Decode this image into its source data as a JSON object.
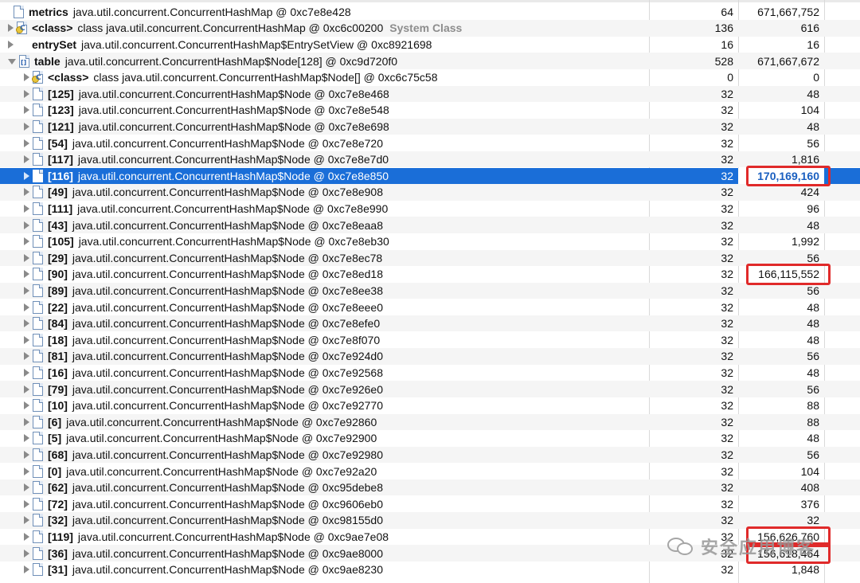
{
  "rows": [
    {
      "indent": 0,
      "toggle": "none",
      "icon": "file",
      "key": "metrics",
      "val": "java.util.concurrent.ConcurrentHashMap @ 0xc7e8e428",
      "shallow": "64",
      "retained": "671,667,752"
    },
    {
      "indent": 1,
      "toggle": "right",
      "icon": "class",
      "key": "<class>",
      "val": "class java.util.concurrent.ConcurrentHashMap @ 0xc6c00200",
      "extra": "System Class",
      "shallow": "136",
      "retained": "616"
    },
    {
      "indent": 1,
      "toggle": "right",
      "icon": "none",
      "key": "entrySet",
      "val": "java.util.concurrent.ConcurrentHashMap$EntrySetView @ 0xc8921698",
      "shallow": "16",
      "retained": "16"
    },
    {
      "indent": 1,
      "toggle": "down",
      "icon": "array",
      "key": "table",
      "val": "java.util.concurrent.ConcurrentHashMap$Node[128] @ 0xc9d720f0",
      "shallow": "528",
      "retained": "671,667,672"
    },
    {
      "indent": 2,
      "toggle": "right",
      "icon": "class",
      "key": "<class>",
      "val": "class java.util.concurrent.ConcurrentHashMap$Node[] @ 0xc6c75c58",
      "shallow": "0",
      "retained": "0"
    },
    {
      "indent": 2,
      "toggle": "right",
      "icon": "file",
      "key": "[125]",
      "val": "java.util.concurrent.ConcurrentHashMap$Node @ 0xc7e8e468",
      "shallow": "32",
      "retained": "48"
    },
    {
      "indent": 2,
      "toggle": "right",
      "icon": "file",
      "key": "[123]",
      "val": "java.util.concurrent.ConcurrentHashMap$Node @ 0xc7e8e548",
      "shallow": "32",
      "retained": "104"
    },
    {
      "indent": 2,
      "toggle": "right",
      "icon": "file",
      "key": "[121]",
      "val": "java.util.concurrent.ConcurrentHashMap$Node @ 0xc7e8e698",
      "shallow": "32",
      "retained": "48"
    },
    {
      "indent": 2,
      "toggle": "right",
      "icon": "file",
      "key": "[54]",
      "val": "java.util.concurrent.ConcurrentHashMap$Node @ 0xc7e8e720",
      "shallow": "32",
      "retained": "56"
    },
    {
      "indent": 2,
      "toggle": "right",
      "icon": "file",
      "key": "[117]",
      "val": "java.util.concurrent.ConcurrentHashMap$Node @ 0xc7e8e7d0",
      "shallow": "32",
      "retained": "1,816"
    },
    {
      "indent": 2,
      "toggle": "right",
      "icon": "file",
      "key": "[116]",
      "val": "java.util.concurrent.ConcurrentHashMap$Node @ 0xc7e8e850",
      "shallow": "32",
      "retained": "170,169,160",
      "selected": true,
      "highlight": true
    },
    {
      "indent": 2,
      "toggle": "right",
      "icon": "file",
      "key": "[49]",
      "val": "java.util.concurrent.ConcurrentHashMap$Node @ 0xc7e8e908",
      "shallow": "32",
      "retained": "424"
    },
    {
      "indent": 2,
      "toggle": "right",
      "icon": "file",
      "key": "[111]",
      "val": "java.util.concurrent.ConcurrentHashMap$Node @ 0xc7e8e990",
      "shallow": "32",
      "retained": "96"
    },
    {
      "indent": 2,
      "toggle": "right",
      "icon": "file",
      "key": "[43]",
      "val": "java.util.concurrent.ConcurrentHashMap$Node @ 0xc7e8eaa8",
      "shallow": "32",
      "retained": "48"
    },
    {
      "indent": 2,
      "toggle": "right",
      "icon": "file",
      "key": "[105]",
      "val": "java.util.concurrent.ConcurrentHashMap$Node @ 0xc7e8eb30",
      "shallow": "32",
      "retained": "1,992"
    },
    {
      "indent": 2,
      "toggle": "right",
      "icon": "file",
      "key": "[29]",
      "val": "java.util.concurrent.ConcurrentHashMap$Node @ 0xc7e8ec78",
      "shallow": "32",
      "retained": "56"
    },
    {
      "indent": 2,
      "toggle": "right",
      "icon": "file",
      "key": "[90]",
      "val": "java.util.concurrent.ConcurrentHashMap$Node @ 0xc7e8ed18",
      "shallow": "32",
      "retained": "166,115,552",
      "highlight": true
    },
    {
      "indent": 2,
      "toggle": "right",
      "icon": "file",
      "key": "[89]",
      "val": "java.util.concurrent.ConcurrentHashMap$Node @ 0xc7e8ee38",
      "shallow": "32",
      "retained": "56"
    },
    {
      "indent": 2,
      "toggle": "right",
      "icon": "file",
      "key": "[22]",
      "val": "java.util.concurrent.ConcurrentHashMap$Node @ 0xc7e8eee0",
      "shallow": "32",
      "retained": "48"
    },
    {
      "indent": 2,
      "toggle": "right",
      "icon": "file",
      "key": "[84]",
      "val": "java.util.concurrent.ConcurrentHashMap$Node @ 0xc7e8efe0",
      "shallow": "32",
      "retained": "48"
    },
    {
      "indent": 2,
      "toggle": "right",
      "icon": "file",
      "key": "[18]",
      "val": "java.util.concurrent.ConcurrentHashMap$Node @ 0xc7e8f070",
      "shallow": "32",
      "retained": "48"
    },
    {
      "indent": 2,
      "toggle": "right",
      "icon": "file",
      "key": "[81]",
      "val": "java.util.concurrent.ConcurrentHashMap$Node @ 0xc7e924d0",
      "shallow": "32",
      "retained": "56"
    },
    {
      "indent": 2,
      "toggle": "right",
      "icon": "file",
      "key": "[16]",
      "val": "java.util.concurrent.ConcurrentHashMap$Node @ 0xc7e92568",
      "shallow": "32",
      "retained": "48"
    },
    {
      "indent": 2,
      "toggle": "right",
      "icon": "file",
      "key": "[79]",
      "val": "java.util.concurrent.ConcurrentHashMap$Node @ 0xc7e926e0",
      "shallow": "32",
      "retained": "56"
    },
    {
      "indent": 2,
      "toggle": "right",
      "icon": "file",
      "key": "[10]",
      "val": "java.util.concurrent.ConcurrentHashMap$Node @ 0xc7e92770",
      "shallow": "32",
      "retained": "88"
    },
    {
      "indent": 2,
      "toggle": "right",
      "icon": "file",
      "key": "[6]",
      "val": "java.util.concurrent.ConcurrentHashMap$Node @ 0xc7e92860",
      "shallow": "32",
      "retained": "88"
    },
    {
      "indent": 2,
      "toggle": "right",
      "icon": "file",
      "key": "[5]",
      "val": "java.util.concurrent.ConcurrentHashMap$Node @ 0xc7e92900",
      "shallow": "32",
      "retained": "48"
    },
    {
      "indent": 2,
      "toggle": "right",
      "icon": "file",
      "key": "[68]",
      "val": "java.util.concurrent.ConcurrentHashMap$Node @ 0xc7e92980",
      "shallow": "32",
      "retained": "56"
    },
    {
      "indent": 2,
      "toggle": "right",
      "icon": "file",
      "key": "[0]",
      "val": "java.util.concurrent.ConcurrentHashMap$Node @ 0xc7e92a20",
      "shallow": "32",
      "retained": "104"
    },
    {
      "indent": 2,
      "toggle": "right",
      "icon": "file",
      "key": "[62]",
      "val": "java.util.concurrent.ConcurrentHashMap$Node @ 0xc95debe8",
      "shallow": "32",
      "retained": "408"
    },
    {
      "indent": 2,
      "toggle": "right",
      "icon": "file",
      "key": "[72]",
      "val": "java.util.concurrent.ConcurrentHashMap$Node @ 0xc9606eb0",
      "shallow": "32",
      "retained": "376"
    },
    {
      "indent": 2,
      "toggle": "right",
      "icon": "file",
      "key": "[32]",
      "val": "java.util.concurrent.ConcurrentHashMap$Node @ 0xc98155d0",
      "shallow": "32",
      "retained": "32"
    },
    {
      "indent": 2,
      "toggle": "right",
      "icon": "file",
      "key": "[119]",
      "val": "java.util.concurrent.ConcurrentHashMap$Node @ 0xc9ae7e08",
      "shallow": "32",
      "retained": "156,626,760",
      "highlight": true
    },
    {
      "indent": 2,
      "toggle": "right",
      "icon": "file",
      "key": "[36]",
      "val": "java.util.concurrent.ConcurrentHashMap$Node @ 0xc9ae8000",
      "shallow": "32",
      "retained": "156,618,464",
      "highlight": true
    },
    {
      "indent": 2,
      "toggle": "right",
      "icon": "file",
      "key": "[31]",
      "val": "java.util.concurrent.ConcurrentHashMap$Node @ 0xc9ae8230",
      "shallow": "32",
      "retained": "1,848"
    }
  ],
  "watermark": {
    "text": "安全应用博客"
  },
  "colors": {
    "selection": "#1a6ed8",
    "highlight_box": "#e02a2a"
  }
}
